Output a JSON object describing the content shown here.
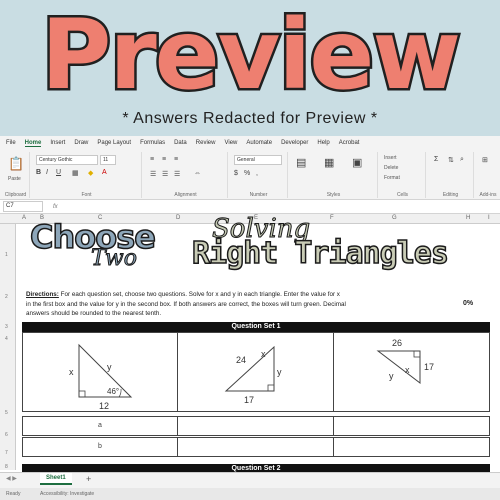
{
  "overlay": {
    "title": "Preview",
    "subtitle": "* Answers Redacted for Preview *"
  },
  "menu": [
    "File",
    "Home",
    "Insert",
    "Draw",
    "Page Layout",
    "Formulas",
    "Data",
    "Review",
    "View",
    "Automate",
    "Developer",
    "Help",
    "Acrobat"
  ],
  "ribbon": {
    "font_name": "Century Gothic",
    "font_size": "11",
    "paste_label": "Paste",
    "groups": [
      "Clipboard",
      "Font",
      "Alignment",
      "Number",
      "Styles",
      "Cells",
      "Editing",
      "Add-ins"
    ],
    "number_format": "General",
    "cell_items": [
      "Insert",
      "Delete",
      "Format"
    ]
  },
  "formula_bar": {
    "cell_ref": "C7",
    "fx": "fx"
  },
  "columns": [
    "A",
    "B",
    "C",
    "D",
    "E",
    "F",
    "G",
    "H",
    "I"
  ],
  "rows": [
    "1",
    "2",
    "3",
    "4",
    "5",
    "6",
    "7",
    "8"
  ],
  "worksheet": {
    "heading_choose": "Choose",
    "heading_two": "Two",
    "heading_solving": "Solving",
    "heading_right": "Right Triangles",
    "directions_label": "Directions:",
    "directions_text": "For each question set, choose two questions.  Solve for x and y in each triangle. Enter the value for x in the first box and the value for y in the second box.  If both answers are correct, the boxes will turn green.   Decimal answers should be rounded to the nearest tenth.",
    "percent": "0%",
    "question_set_1": "Question Set 1",
    "question_set_2": "Question Set 2",
    "triangles": [
      {
        "x": "x",
        "y": "y",
        "angle": "46°",
        "side": "12"
      },
      {
        "x": "x",
        "y": "y",
        "side_a": "24",
        "side_b": "17"
      },
      {
        "x": "x",
        "y": "y",
        "side_a": "26",
        "side_b": "17"
      }
    ],
    "answer_labels": [
      "a",
      "b"
    ]
  },
  "tabs": {
    "sheet_name": "Sheet1",
    "add": "+"
  },
  "status": {
    "ready": "Ready",
    "accessibility": "Accessibility: Investigate"
  }
}
